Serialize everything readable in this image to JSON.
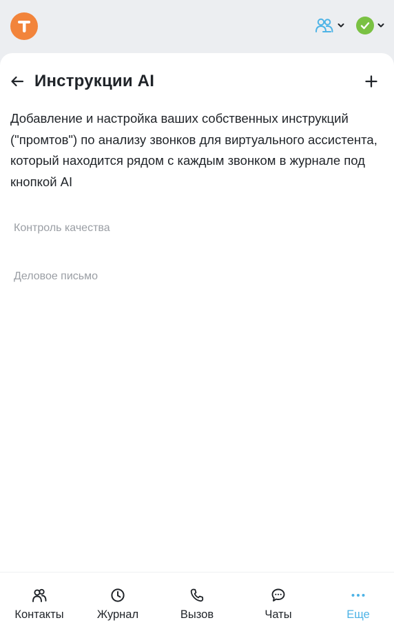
{
  "topbar": {
    "logo_letter": "T",
    "logo_color": "#f2843b",
    "users_icon": "users-icon",
    "status_icon": "check-circle-icon",
    "status_color": "#7ac143",
    "accent_color": "#4db3e6"
  },
  "header": {
    "title": "Инструкции AI",
    "back_icon": "arrow-left-icon",
    "add_icon": "plus-icon"
  },
  "description": "Добавление и настройка ваших собственных инструкций (\"промтов\") по анализу звонков для виртуального ассистента, который находится рядом с каждым звонком в журнале под кнопкой AI",
  "prompts": [
    {
      "label": "Контроль качества"
    },
    {
      "label": "Деловое письмо"
    }
  ],
  "nav": {
    "items": [
      {
        "label": "Контакты",
        "icon": "contacts-icon"
      },
      {
        "label": "Журнал",
        "icon": "clock-icon"
      },
      {
        "label": "Вызов",
        "icon": "phone-icon"
      },
      {
        "label": "Чаты",
        "icon": "chat-icon"
      },
      {
        "label": "Еще",
        "icon": "more-icon",
        "active": true
      }
    ]
  }
}
